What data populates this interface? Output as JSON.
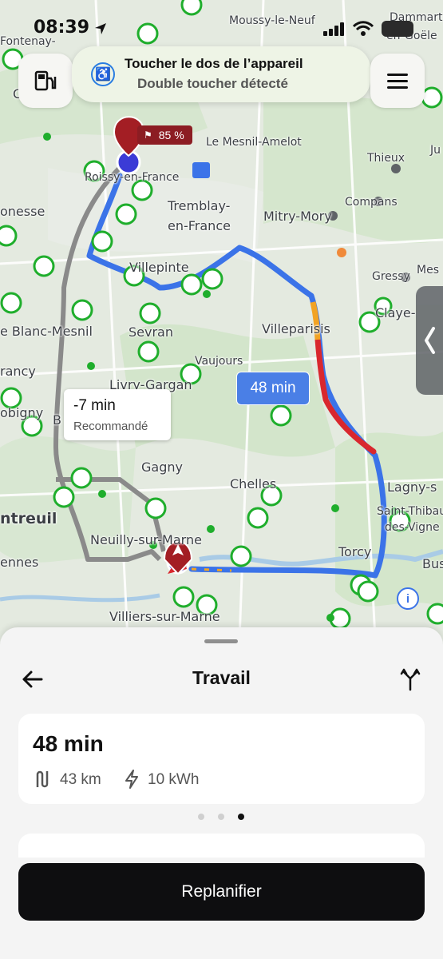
{
  "status_bar": {
    "time": "08:39"
  },
  "toast": {
    "title": "Toucher le dos de l’appareil",
    "subtitle": "Double toucher détecté"
  },
  "map": {
    "destination_badge": "85 %",
    "route_bubble_alt": {
      "time": "-7 min",
      "note": "Recommandé"
    },
    "route_bubble_main": "48 min",
    "places": [
      {
        "name": "Moussy-le-Neuf"
      },
      {
        "name": "Dammartin"
      },
      {
        "name": "en-Goële"
      },
      {
        "name": "Fontenay-"
      },
      {
        "name": "Le Mesnil-Amelot"
      },
      {
        "name": "Thieux"
      },
      {
        "name": "Roissy-en-France"
      },
      {
        "name": "Compans"
      },
      {
        "name": "onesse"
      },
      {
        "name": "Tremblay-"
      },
      {
        "name": "en-France"
      },
      {
        "name": "Mitry-Mory"
      },
      {
        "name": "Villepinte"
      },
      {
        "name": "Gressy"
      },
      {
        "name": "Claye-"
      },
      {
        "name": "e Blanc-Mesnil"
      },
      {
        "name": "Sevran"
      },
      {
        "name": "Villeparisis"
      },
      {
        "name": "rancy"
      },
      {
        "name": "Vaujours"
      },
      {
        "name": "Livry-Gargan"
      },
      {
        "name": "obigny"
      },
      {
        "name": "B"
      },
      {
        "name": "Gagny"
      },
      {
        "name": "Chelles"
      },
      {
        "name": "Lagny-s"
      },
      {
        "name": "ntreuil"
      },
      {
        "name": "Saint-Thibau"
      },
      {
        "name": "des-Vigne"
      },
      {
        "name": "Neuilly-sur-Marne"
      },
      {
        "name": "Torcy"
      },
      {
        "name": "ennes"
      },
      {
        "name": "Bus"
      },
      {
        "name": "Villiers-sur-Marne"
      },
      {
        "name": "Ju"
      },
      {
        "name": "Mes"
      },
      {
        "name": "C"
      }
    ],
    "colors": {
      "route": "#3b73e8",
      "alt_route": "#8a8a8a",
      "traffic": "#d9272e",
      "charger": "#1fae2c"
    }
  },
  "sheet": {
    "title": "Travail",
    "duration": "48 min",
    "distance": "43 km",
    "energy": "10 kWh",
    "page_dots": [
      false,
      false,
      true
    ],
    "cta": "Replanifier"
  },
  "icons": [
    "back-arrow-icon",
    "route-split-icon",
    "charging-station-icon",
    "menu-icon",
    "accessibility-icon",
    "route-distance-icon",
    "bolt-icon",
    "chevron-left-icon",
    "location-arrow-icon",
    "info-icon",
    "flag-icon"
  ]
}
